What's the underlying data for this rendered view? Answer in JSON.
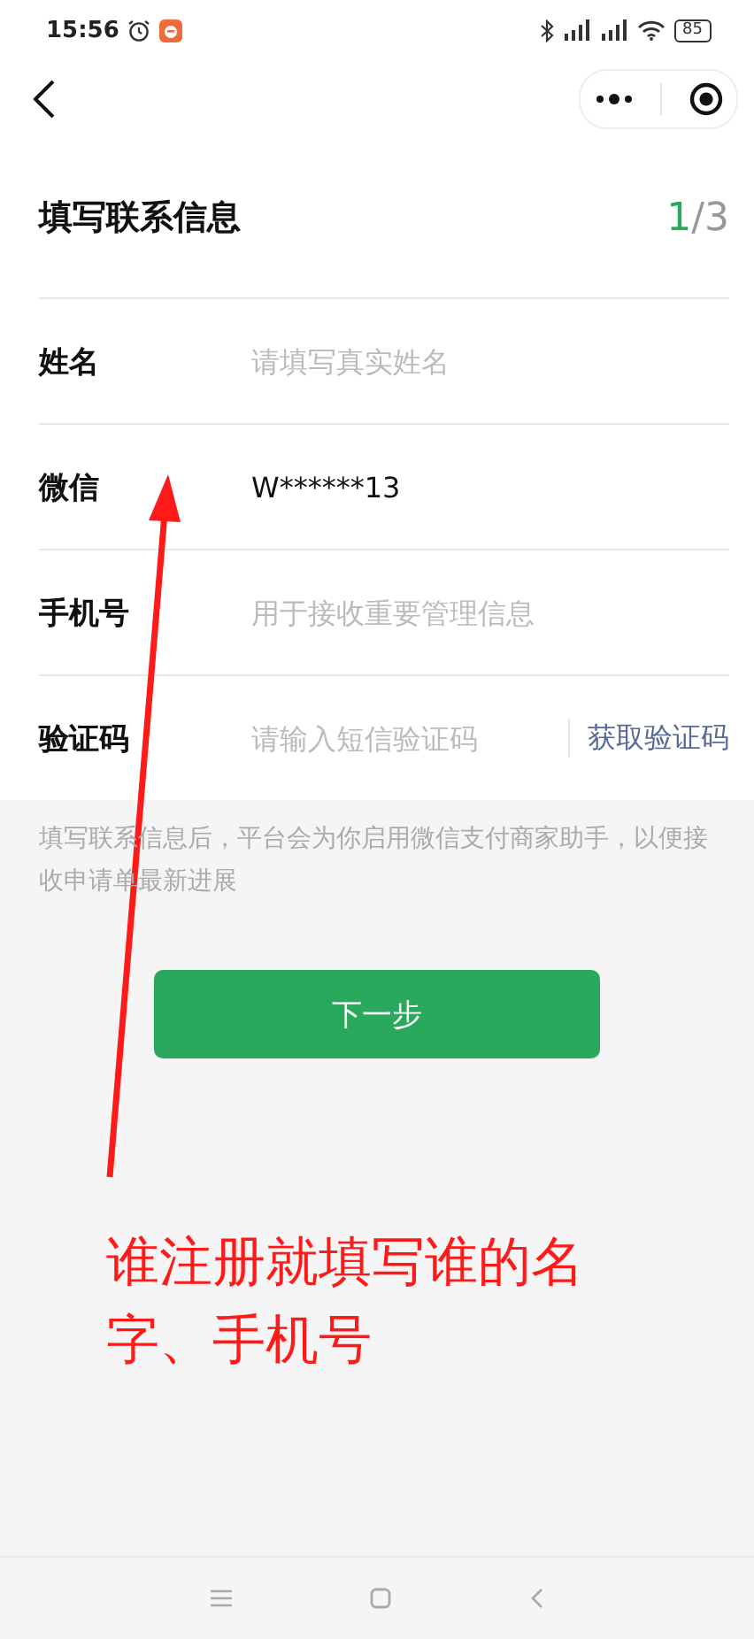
{
  "status_bar": {
    "time": "15:56",
    "battery": "85"
  },
  "title": "填写联系信息",
  "step": {
    "current": "1",
    "total": "/3"
  },
  "fields": [
    {
      "label": "姓名",
      "placeholder": "请填写真实姓名"
    },
    {
      "label": "微信",
      "value": "W******13"
    },
    {
      "label": "手机号",
      "placeholder": "用于接收重要管理信息"
    },
    {
      "label": "验证码",
      "placeholder": "请输入短信验证码",
      "action": "获取验证码"
    }
  ],
  "note": "填写联系信息后，平台会为你启用微信支付商家助手，以便接收申请单最新进展",
  "next_button": "下一步",
  "annotation": "谁注册就填写谁的名字、手机号"
}
